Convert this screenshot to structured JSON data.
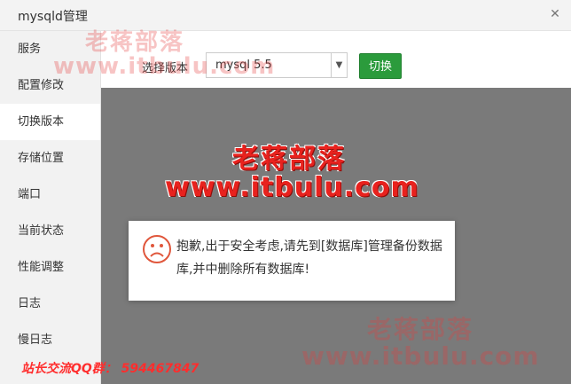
{
  "window": {
    "title": "mysqld管理"
  },
  "sidebar": {
    "items": [
      {
        "label": "服务"
      },
      {
        "label": "配置修改"
      },
      {
        "label": "切换版本"
      },
      {
        "label": "存储位置"
      },
      {
        "label": "端口"
      },
      {
        "label": "当前状态"
      },
      {
        "label": "性能调整"
      },
      {
        "label": "日志"
      },
      {
        "label": "慢日志"
      }
    ],
    "active_index": 2
  },
  "version_panel": {
    "label": "选择版本",
    "selected": "mysql 5.5",
    "switch_button": "切换"
  },
  "message": {
    "icon": "sad-face-icon",
    "text": "抱歉,出于安全考虑,请先到[数据库]管理备份数据库,并中删除所有数据库!"
  },
  "watermark": {
    "brand": "老蒋部落",
    "site": "www.itbulu.com",
    "qq_group": "站长交流QQ群：  594467847"
  },
  "colors": {
    "accent_green": "#2b9b3c",
    "watermark_red": "#e8221e",
    "overlay_gray": "#7a7a7a",
    "sidebar_bg": "#f2f2f2"
  }
}
